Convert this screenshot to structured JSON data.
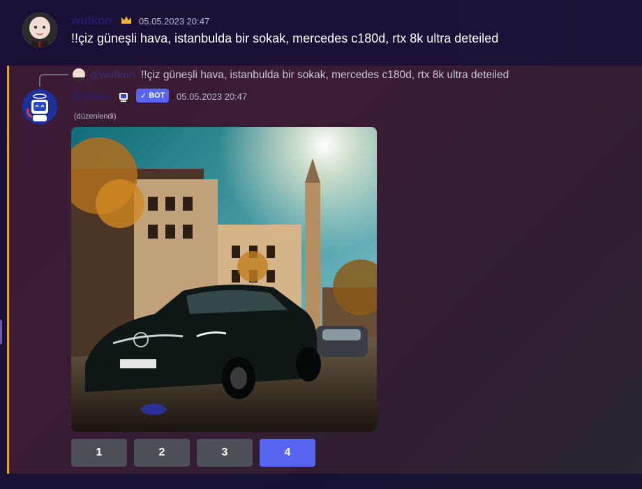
{
  "first_message": {
    "username": "wulknn",
    "timestamp": "05.05.2023 20:47",
    "text": "!!çiz güneşli hava, istanbulda bir sokak, mercedes c180d, rtx 8k ultra deteiled",
    "crown_icon": "crown-icon"
  },
  "reply": {
    "mention": "@wulknn",
    "text": "!!çiz güneşli hava, istanbulda bir sokak, mercedes c180d, rtx 8k ultra deteiled"
  },
  "bot_message": {
    "username": "Cortex",
    "bot_tag": "BOT",
    "timestamp": "05.05.2023 20:47",
    "edited_label": "(düzenlendi)"
  },
  "buttons": [
    {
      "label": "1",
      "active": false
    },
    {
      "label": "2",
      "active": false
    },
    {
      "label": "3",
      "active": false
    },
    {
      "label": "4",
      "active": true
    }
  ],
  "colors": {
    "accent": "#5865f2",
    "button": "#4e5058",
    "highlight_border": "#e5a52a"
  }
}
